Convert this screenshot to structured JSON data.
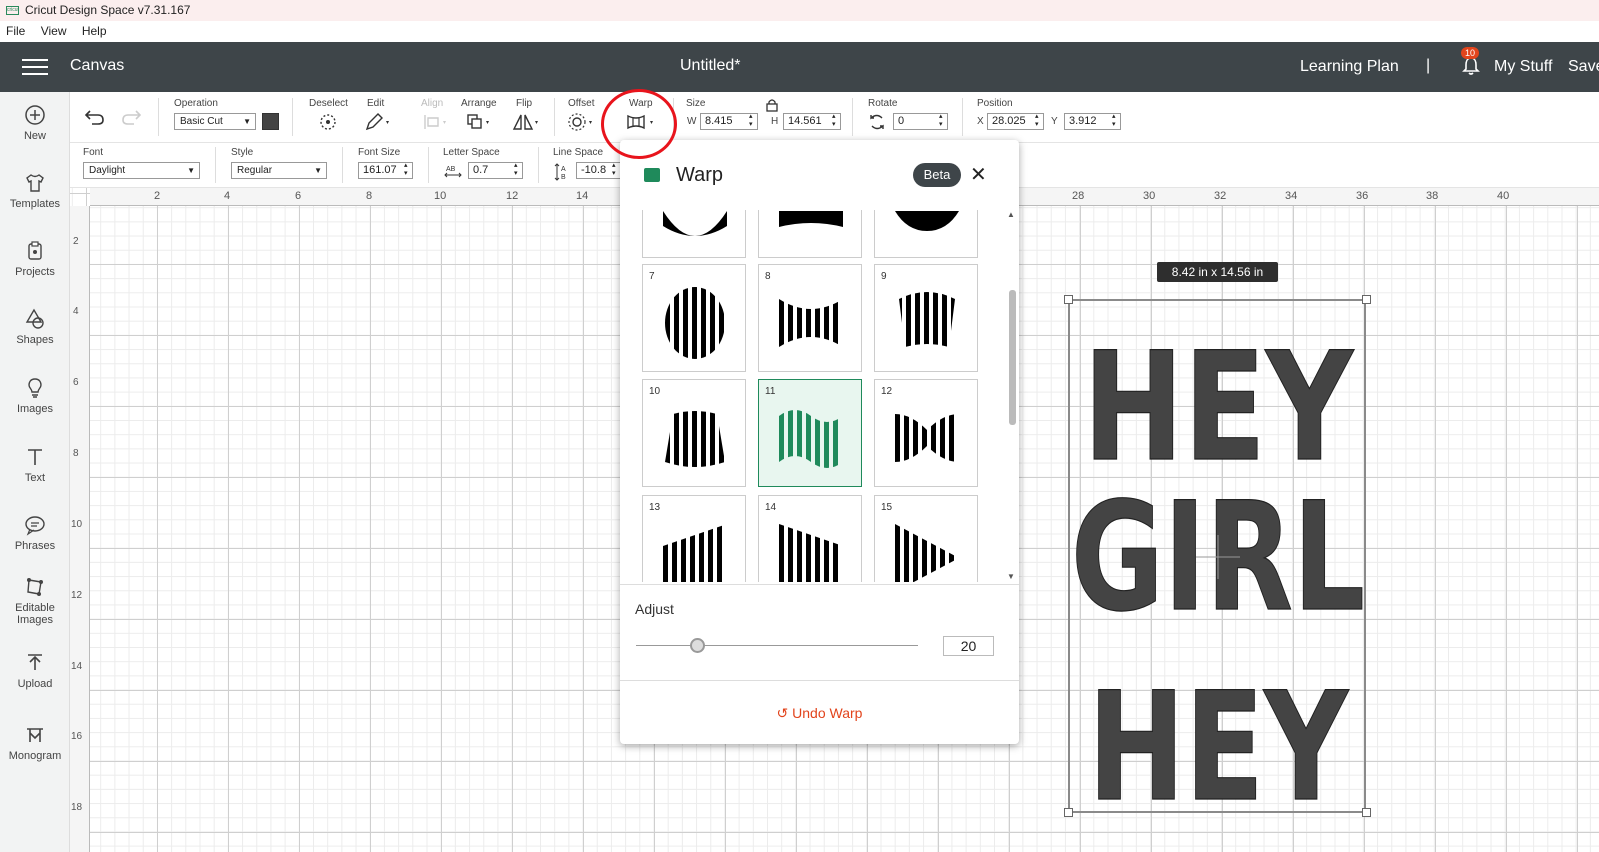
{
  "window": {
    "title": "Cricut Design Space  v7.31.167",
    "logo_text": "cricut"
  },
  "menu": [
    "File",
    "View",
    "Help"
  ],
  "header": {
    "section": "Canvas",
    "doc_title": "Untitled*",
    "learning": "Learning Plan",
    "separator": "|",
    "notif_count": "10",
    "mystuff": "My Stuff",
    "save": "Save"
  },
  "sidebar": [
    {
      "label": "New",
      "icon": "plus-circle-icon"
    },
    {
      "label": "Templates",
      "icon": "shirt-icon"
    },
    {
      "label": "Projects",
      "icon": "clipboard-icon"
    },
    {
      "label": "Shapes",
      "icon": "shapes-icon"
    },
    {
      "label": "Images",
      "icon": "lightbulb-icon"
    },
    {
      "label": "Text",
      "icon": "text-T-icon"
    },
    {
      "label": "Phrases",
      "icon": "speech-bubble-icon"
    },
    {
      "label": "Editable Images",
      "icon": "editable-image-icon"
    },
    {
      "label": "Upload",
      "icon": "upload-icon"
    },
    {
      "label": "Monogram",
      "icon": "monogram-icon"
    }
  ],
  "toolbar": {
    "operation_label": "Operation",
    "operation_value": "Basic Cut",
    "deselect": "Deselect",
    "edit": "Edit",
    "align": "Align",
    "arrange": "Arrange",
    "flip": "Flip",
    "offset": "Offset",
    "warp": "Warp",
    "size": "Size",
    "w_label": "W",
    "w": "8.415",
    "h_label": "H",
    "h": "14.561",
    "rotate": "Rotate",
    "rotate_value": "0",
    "position": "Position",
    "x_label": "X",
    "x": "28.025",
    "y_label": "Y",
    "y": "3.912",
    "color": "#444444"
  },
  "text_toolbar": {
    "font_label": "Font",
    "font": "Daylight",
    "style_label": "Style",
    "style": "Regular",
    "font_size_label": "Font Size",
    "font_size": "161.07",
    "letter_space_label": "Letter Space",
    "letter_space": "0.7",
    "line_space_label": "Line Space",
    "line_space": "-10.8"
  },
  "ruler": {
    "h": [
      "2",
      "4",
      "6",
      "8",
      "10",
      "12",
      "14",
      "28",
      "30",
      "32",
      "34",
      "36",
      "38",
      "40"
    ],
    "v": [
      "2",
      "4",
      "6",
      "8",
      "10",
      "12",
      "14",
      "16",
      "18"
    ]
  },
  "warp_panel": {
    "title": "Warp",
    "beta": "Beta",
    "close": "✕",
    "cells": [
      "7",
      "8",
      "9",
      "10",
      "11",
      "12",
      "13",
      "14",
      "15"
    ],
    "selected": "11",
    "adjust_label": "Adjust",
    "adjust_value": "20",
    "undo": "Undo Warp"
  },
  "selection": {
    "size_badge": "8.42  in x 14.56  in"
  },
  "design_text": {
    "line1": "HEY",
    "line2": "GIRL",
    "line3": "HEY"
  },
  "colors": {
    "accent": "#1f8a5b",
    "header": "#3e4549",
    "undo": "#e2441c",
    "highlight_circle": "#e8141c"
  }
}
